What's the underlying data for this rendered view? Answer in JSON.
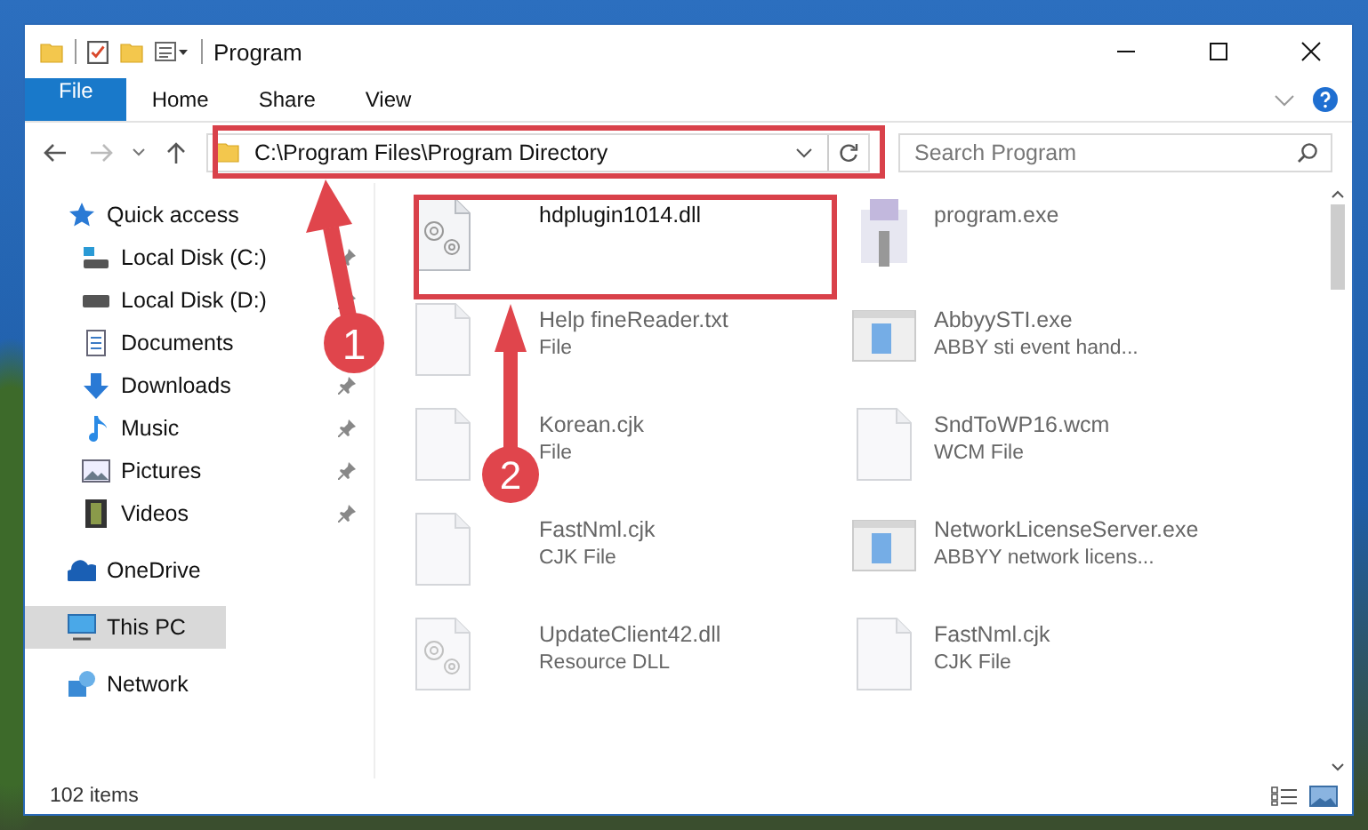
{
  "window": {
    "title": "Program"
  },
  "ribbon_tabs": [
    {
      "label": "File",
      "kind": "file"
    },
    {
      "label": "Home",
      "kind": "tab"
    },
    {
      "label": "Share",
      "kind": "tab"
    },
    {
      "label": "View",
      "kind": "tab"
    }
  ],
  "address_bar": {
    "path": "C:\\Program Files\\Program Directory"
  },
  "search": {
    "placeholder": "Search Program"
  },
  "sidebar": {
    "items": [
      {
        "label": "Quick access",
        "kind": "star",
        "selected": false,
        "children": [
          {
            "label": "Local Disk (C:)",
            "kind": "system",
            "pinned": true,
            "selected": false
          },
          {
            "label": "Local Disk (D:)",
            "kind": "drive",
            "pinned": true,
            "selected": false
          },
          {
            "label": "Documents",
            "kind": "document",
            "selected": false
          },
          {
            "label": "Downloads",
            "kind": "download",
            "pinned": true,
            "selected": false
          },
          {
            "label": "Music",
            "kind": "music",
            "pinned": true,
            "selected": false
          },
          {
            "label": "Pictures",
            "kind": "pictures",
            "pinned": true,
            "selected": false
          },
          {
            "label": "Videos",
            "kind": "videos",
            "pinned": true,
            "selected": false
          }
        ]
      },
      {
        "label": "OneDrive",
        "kind": "cloud",
        "selected": false
      },
      {
        "label": "This PC",
        "kind": "computer",
        "selected": true
      },
      {
        "label": "Network",
        "kind": "network",
        "selected": false
      }
    ]
  },
  "files": [
    {
      "name": "hdplugin1014.dll",
      "kind": "gears",
      "dimmed": false
    },
    {
      "name": "program.exe",
      "kind": "installer",
      "dimmed": true
    },
    {
      "name": "Help fineReader.txt",
      "type": "File",
      "kind": "blank",
      "dimmed": true
    },
    {
      "name": "AbbyySTI.exe",
      "type": "ABBY sti event hand...",
      "kind": "app",
      "dimmed": true
    },
    {
      "name": "Korean.cjk",
      "type": "File",
      "kind": "blank",
      "dimmed": true
    },
    {
      "name": "SndToWP16.wcm",
      "type": "WCM File",
      "kind": "blank",
      "dimmed": true
    },
    {
      "name": "FastNml.cjk",
      "type": "CJK File",
      "kind": "blank",
      "dimmed": true
    },
    {
      "name": "NetworkLicenseServer.exe",
      "type": "ABBYY network licens...",
      "kind": "app",
      "dimmed": true
    },
    {
      "name": "UpdateClient42.dll",
      "type": "Resource DLL",
      "kind": "gears",
      "dimmed": true
    },
    {
      "name": "FastNml.cjk",
      "type": "CJK File",
      "kind": "blank",
      "dimmed": true
    }
  ],
  "status_bar": {
    "count": "102 items"
  },
  "callouts": [
    {
      "number": "1"
    },
    {
      "number": "2"
    }
  ]
}
